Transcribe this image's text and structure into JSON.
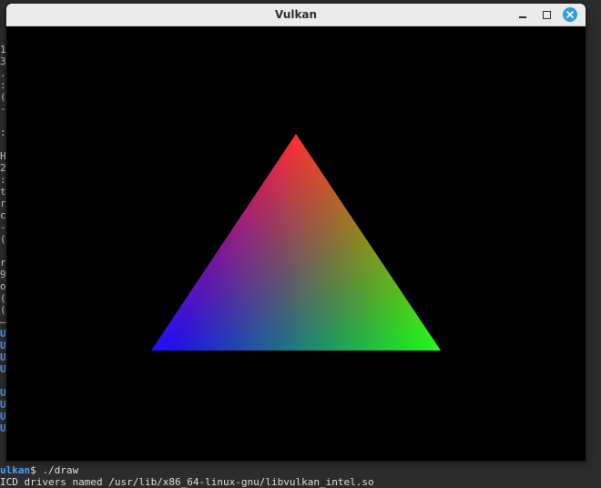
{
  "window": {
    "title": "Vulkan",
    "controls": {
      "minimize": "minimize-icon",
      "maximize": "maximize-icon",
      "close": "close-icon"
    }
  },
  "scene": {
    "shape": "triangle",
    "vertex_colors": {
      "top": "#ff2020",
      "bottom_left": "#2010ff",
      "bottom_right": "#20ff20"
    },
    "background": "#000000"
  },
  "terminal": {
    "gutter_lines": [
      "1",
      "3",
      ".",
      ":",
      "(",
      "-",
      "",
      ":",
      "",
      "H",
      "2",
      ":",
      "t",
      "r",
      "c",
      "-",
      "(",
      "",
      "r",
      "9",
      "o",
      "(",
      "(",
      "–",
      "U",
      "U",
      "U",
      "U",
      "",
      "U",
      "U",
      "U",
      "U",
      "",
      ""
    ],
    "prompt_user": "ulkan",
    "prompt_command": "$ ./draw",
    "last_line": "ICD drivers named /usr/lib/x86_64-linux-gnu/libvulkan_intel.so"
  }
}
